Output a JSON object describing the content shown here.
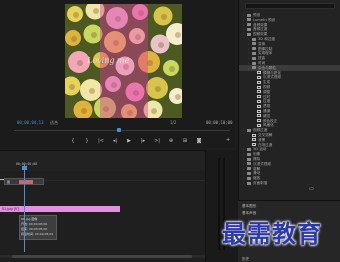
{
  "monitor": {
    "frame_caption": "Loving me",
    "timecode_current": "00;00;04;13",
    "zoom_level": "适合",
    "resolution": "1/2",
    "timecode_duration": "00;00;10;00",
    "transport_icons": [
      "mark-in-icon",
      "mark-out-icon",
      "go-to-in-icon",
      "step-back-icon",
      "play-icon",
      "step-forward-icon",
      "go-to-out-icon",
      "insert-icon",
      "overwrite-icon",
      "export-frame-icon"
    ]
  },
  "effects": {
    "search_placeholder": "",
    "tree": [
      {
        "label": "预设",
        "depth": 0,
        "type": "folder"
      },
      {
        "label": "Lumetri 预设",
        "depth": 0,
        "type": "folder"
      },
      {
        "label": "音频效果",
        "depth": 0,
        "type": "folder"
      },
      {
        "label": "音频过渡",
        "depth": 0,
        "type": "folder"
      },
      {
        "label": "视频效果",
        "depth": 0,
        "type": "folder"
      },
      {
        "label": "3D 和过渡",
        "depth": 1,
        "type": "folder"
      },
      {
        "label": "变换",
        "depth": 1,
        "type": "folder"
      },
      {
        "label": "图像控制",
        "depth": 1,
        "type": "folder"
      },
      {
        "label": "实用程序",
        "depth": 1,
        "type": "folder"
      },
      {
        "label": "扭曲",
        "depth": 1,
        "type": "folder"
      },
      {
        "label": "时间",
        "depth": 1,
        "type": "folder"
      },
      {
        "label": "杂色与颗粒",
        "depth": 1,
        "type": "folder",
        "selected": true
      },
      {
        "label": "模糊与锐化",
        "depth": 2,
        "type": "fx"
      },
      {
        "label": "沉浸式视频",
        "depth": 2,
        "type": "fx"
      },
      {
        "label": "生成",
        "depth": 2,
        "type": "fx"
      },
      {
        "label": "视频",
        "depth": 2,
        "type": "fx"
      },
      {
        "label": "调整",
        "depth": 2,
        "type": "fx"
      },
      {
        "label": "过时",
        "depth": 2,
        "type": "fx"
      },
      {
        "label": "过渡",
        "depth": 2,
        "type": "fx"
      },
      {
        "label": "透视",
        "depth": 2,
        "type": "fx"
      },
      {
        "label": "通道",
        "depth": 2,
        "type": "fx"
      },
      {
        "label": "键控",
        "depth": 2,
        "type": "fx"
      },
      {
        "label": "颜色校正",
        "depth": 2,
        "type": "fx"
      },
      {
        "label": "风格化",
        "depth": 2,
        "type": "fx"
      },
      {
        "label": "视频过渡",
        "depth": 0,
        "type": "folder"
      },
      {
        "label": "交叉溶解",
        "depth": 1,
        "type": "fx"
      },
      {
        "label": "浸黑",
        "depth": 1,
        "type": "fx"
      },
      {
        "label": "白场过渡",
        "depth": 1,
        "type": "fx"
      },
      {
        "label": "3D 运动",
        "depth": 0,
        "type": "folder"
      },
      {
        "label": "划像",
        "depth": 0,
        "type": "folder"
      },
      {
        "label": "擦除",
        "depth": 0,
        "type": "folder"
      },
      {
        "label": "沉浸式视频",
        "depth": 0,
        "type": "folder"
      },
      {
        "label": "溶解",
        "depth": 0,
        "type": "folder"
      },
      {
        "label": "滑动",
        "depth": 0,
        "type": "folder"
      },
      {
        "label": "缩放",
        "depth": 0,
        "type": "folder"
      },
      {
        "label": "页面剥落",
        "depth": 0,
        "type": "folder"
      }
    ]
  },
  "timeline": {
    "ruler_time": "00;00;05;00",
    "clip_small_label": "图",
    "clip_pink_label": "01.jpg [V]",
    "tooltip": [
      "01.jpg 图像",
      "开始: 00;00;00;00",
      "结束: 00;00;05;00",
      "持续时间: 00;00;05;01"
    ]
  },
  "lower_right": {
    "label1": "基本图形",
    "label2": "基本声音",
    "bottom": "历史"
  },
  "watermark": "最需教育",
  "colors": {
    "accent": "#4a90d9",
    "clip_pink": "#e58fe0",
    "watermark": "#2c3aa8"
  }
}
